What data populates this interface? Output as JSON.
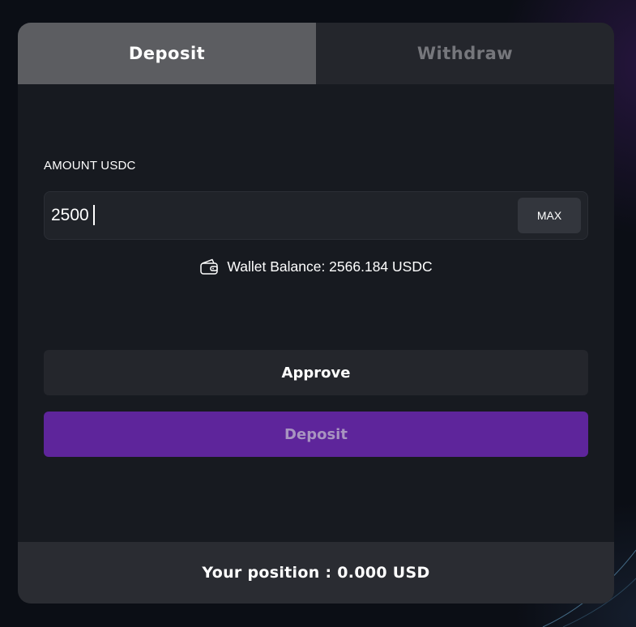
{
  "tabs": {
    "deposit": "Deposit",
    "withdraw": "Withdraw"
  },
  "form": {
    "amount_label": "AMOUNT USDC",
    "amount_value": "2500",
    "max_label": "MAX",
    "wallet_balance": "Wallet Balance: 2566.184 USDC",
    "wallet_icon": "wallet-icon"
  },
  "actions": {
    "approve_label": "Approve",
    "deposit_label": "Deposit"
  },
  "footer": {
    "position_text": "Your position : 0.000 USD"
  },
  "colors": {
    "accent": "#5e259b",
    "active_tab": "#5c5d61",
    "card_bg": "#171a20"
  }
}
